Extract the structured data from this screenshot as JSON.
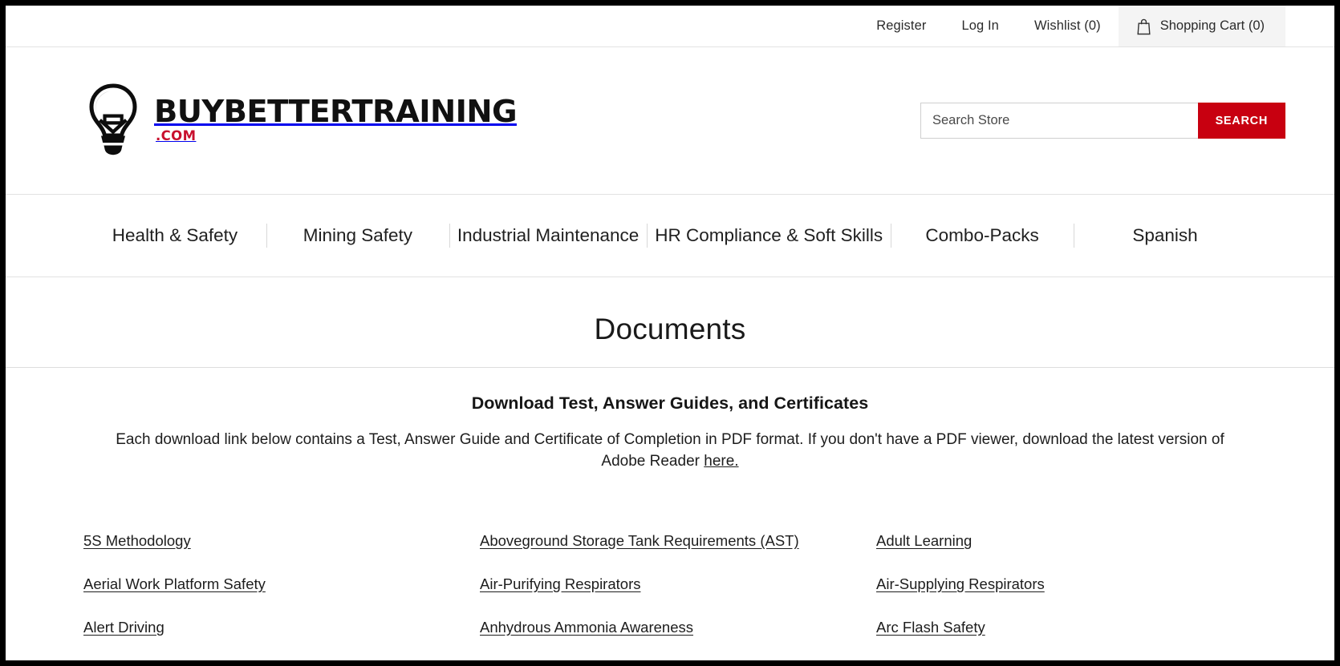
{
  "utility": {
    "links": [
      {
        "label": "Register",
        "name": "register-link"
      },
      {
        "label": "Log In",
        "name": "login-link"
      },
      {
        "label": "Wishlist (0)",
        "name": "wishlist-link"
      }
    ],
    "cart": {
      "label": "Shopping Cart (0)",
      "icon": "shopping-bag-icon",
      "background": "#f4f4f4"
    }
  },
  "brand": {
    "logo_icon": "lightbulb-icon",
    "wordmark_main": "BUYBETTERTRAINING",
    "wordmark_sub": ".COM",
    "wordmark_sub_color": "#c8102e",
    "wordmark_main_color": "#111111"
  },
  "search": {
    "placeholder": "Search Store",
    "value": "",
    "button_label": "SEARCH",
    "button_color": "#c80010"
  },
  "nav": {
    "items": [
      {
        "label": "Health & Safety",
        "name": "nav-health-safety"
      },
      {
        "label": "Mining Safety",
        "name": "nav-mining-safety"
      },
      {
        "label": "Industrial Maintenance",
        "name": "nav-industrial-maintenance"
      },
      {
        "label": "HR Compliance & Soft Skills",
        "name": "nav-hr-compliance"
      },
      {
        "label": "Combo-Packs",
        "name": "nav-combo-packs"
      },
      {
        "label": "Spanish",
        "name": "nav-spanish"
      }
    ]
  },
  "page": {
    "title": "Documents"
  },
  "intro": {
    "heading": "Download Test, Answer Guides, and Certificates",
    "text_before_link": "Each download link below contains a Test, Answer Guide and Certificate of Completion in PDF format. If you don't have a PDF viewer, download the latest version of Adobe Reader ",
    "link_label": "here.",
    "text_after_link": ""
  },
  "documents": {
    "columns": [
      {
        "links": [
          "5S Methodology",
          "Aerial Work Platform Safety",
          "Alert Driving"
        ]
      },
      {
        "links": [
          "Aboveground Storage Tank Requirements (AST)",
          "Air-Purifying Respirators",
          "Anhydrous Ammonia Awareness"
        ]
      },
      {
        "links": [
          "Adult Learning",
          "Air-Supplying Respirators",
          "Arc Flash Safety"
        ]
      }
    ]
  }
}
